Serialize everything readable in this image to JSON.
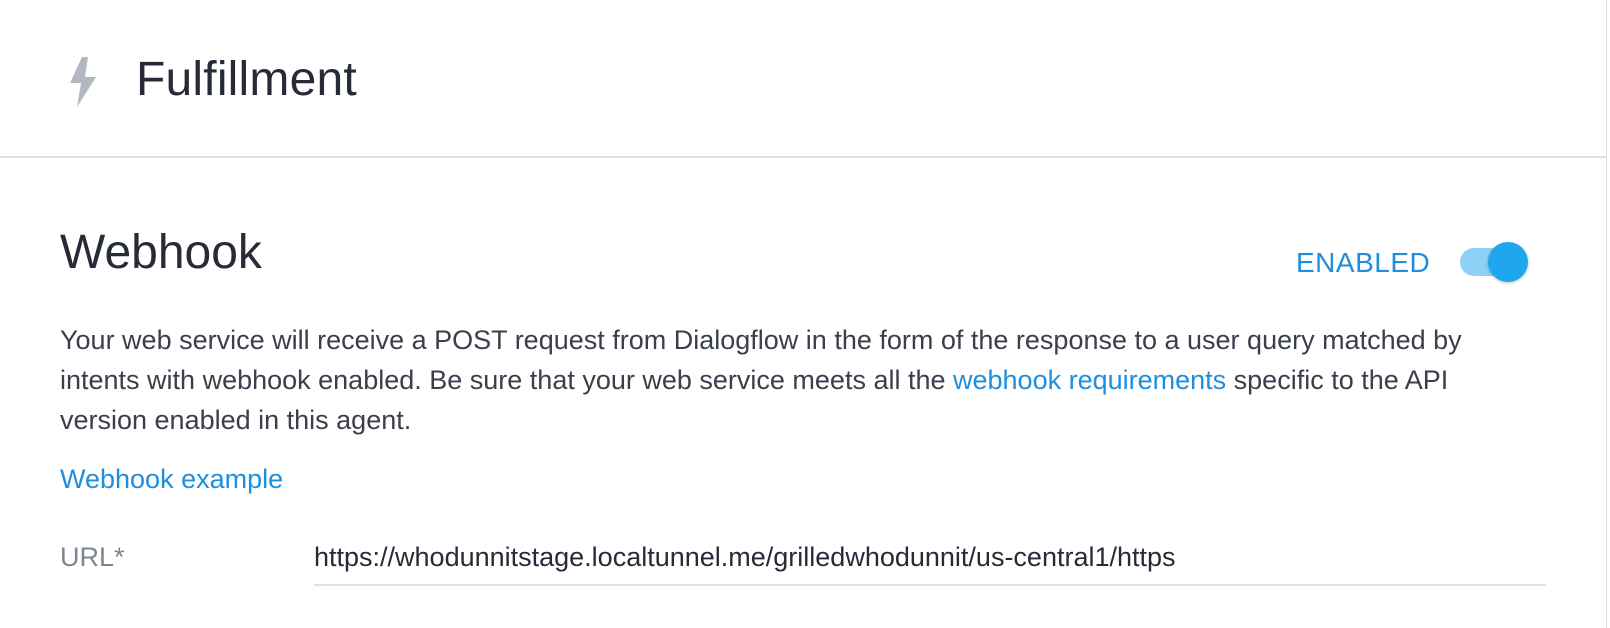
{
  "header": {
    "icon": "lightning-bolt-icon",
    "title": "Fulfillment"
  },
  "webhook": {
    "title": "Webhook",
    "status_label": "ENABLED",
    "enabled": true,
    "description_before_link": "Your web service will receive a POST request from Dialogflow in the form of the response to a user query matched by intents with webhook enabled. Be sure that your web service meets all the ",
    "requirements_link": "webhook requirements",
    "description_after_link": " specific to the API version enabled in this agent.",
    "example_link": "Webhook example",
    "url_label": "URL*",
    "url_value": "https://whodunnitstage.localtunnel.me/grilledwhodunnit/us-central1/https"
  },
  "colors": {
    "accent": "#1e8ede",
    "toggle_thumb": "#1ea7ef",
    "toggle_track": "#8fd0f7",
    "text": "#262b37",
    "icon_gray": "#b3b7bf"
  }
}
